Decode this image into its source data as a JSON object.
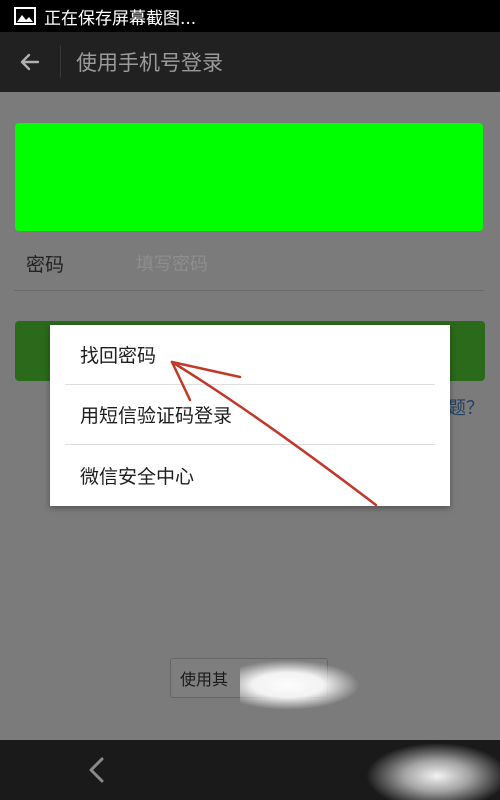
{
  "status_bar": {
    "text": "正在保存屏幕截图..."
  },
  "app_bar": {
    "title": "使用手机号登录"
  },
  "form": {
    "password_label": "密码",
    "password_placeholder": "填写密码",
    "problem_link": "题？",
    "other_button_label": "使用其"
  },
  "menu": {
    "items": [
      {
        "label": "找回密码"
      },
      {
        "label": "用短信验证码登录"
      },
      {
        "label": "微信安全中心"
      }
    ]
  },
  "colors": {
    "green_block": "#00ff00",
    "login_button": "#2a6a1a",
    "annotation_arrow": "#c0392b"
  }
}
